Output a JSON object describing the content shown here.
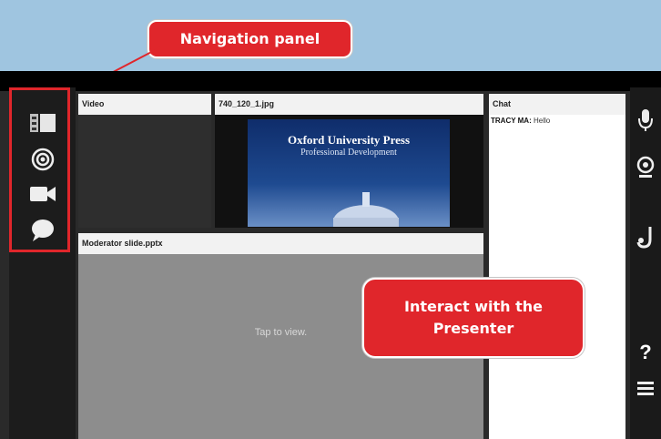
{
  "callouts": {
    "navigation": "Navigation panel",
    "interact_line1": "Interact with the",
    "interact_line2": "Presenter"
  },
  "panels": {
    "video": "Video",
    "image": "740_120_1.jpg",
    "slide": "Moderator slide.pptx",
    "slide_placeholder": "Tap to view.",
    "chat": "Chat"
  },
  "image_content": {
    "title": "Oxford University Press",
    "subtitle": "Professional Development"
  },
  "chat": {
    "messages": [
      {
        "sender": "TRACY MA:",
        "text": "Hello"
      }
    ]
  },
  "nav_icons": [
    "layout-icon",
    "broadcast-icon",
    "video-camera-icon",
    "chat-bubble-icon"
  ],
  "right_icons": [
    "microphone-icon",
    "webcam-icon",
    "raise-hand-icon",
    "help-icon",
    "menu-icon"
  ],
  "help_glyph": "?",
  "colors": {
    "accent": "#e0262b",
    "background": "#9fc5e0"
  }
}
